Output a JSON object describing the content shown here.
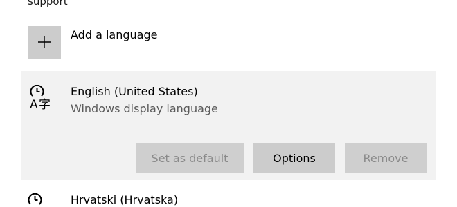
{
  "section_heading_fragment": "support",
  "add_language": {
    "label": "Add a language",
    "icon": "plus-icon"
  },
  "languages": [
    {
      "name": "English (United States)",
      "subtitle": "Windows display language",
      "icon": "language-icon",
      "selected": true,
      "actions": {
        "set_default": {
          "label": "Set as default",
          "enabled": false
        },
        "options": {
          "label": "Options",
          "enabled": true
        },
        "remove": {
          "label": "Remove",
          "enabled": false
        }
      }
    },
    {
      "name": "Hrvatski (Hrvatska)",
      "icon": "language-icon"
    }
  ],
  "colors": {
    "selected_panel_bg": "#f2f2f2",
    "button_bg": "#cccccc",
    "disabled_text": "#8a8a8a",
    "secondary_text": "#5a5a5a"
  }
}
